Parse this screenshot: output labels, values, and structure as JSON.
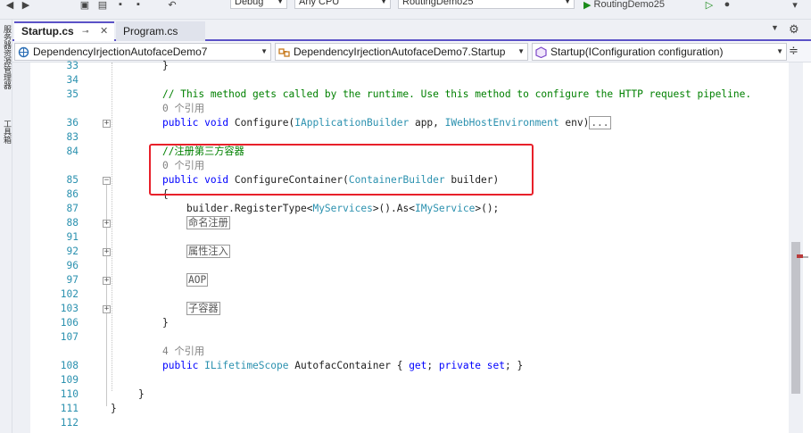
{
  "toolbar": {
    "config": "Debug",
    "platform": "Any CPU",
    "project": "RoutingDemo25",
    "run_target": "RoutingDemo25"
  },
  "left_strip": {
    "item1": "服务器资源管理器",
    "item2": "工具箱"
  },
  "tabs": [
    {
      "label": "Startup.cs",
      "active": true
    },
    {
      "label": "Program.cs",
      "active": false
    }
  ],
  "nav": {
    "project": "DependencyIrjectionAutofaceDemo7",
    "class": "DependencyIrjectionAutofaceDemo7.Startup",
    "member": "Startup(IConfiguration configuration)"
  },
  "code": {
    "l33_ln": "33",
    "l33_brace": "}",
    "l34_ln": "34",
    "l35_ln": "35",
    "l35_comment": "// This method gets called by the runtime. Use this method to configure the HTTP request pipeline.",
    "ref_0": "0 个引用",
    "l36_ln": "36",
    "l36_public": "public",
    "l36_void": "void",
    "l36_name": "Configure(",
    "l36_type1": "IApplicationBuilder",
    "l36_arg1": " app, ",
    "l36_type2": "IWebHostEnvironment",
    "l36_arg2": " env)",
    "ellipsis": "...",
    "l83_ln": "83",
    "l84_ln": "84",
    "l84_comment": "//注册第三方容器",
    "ref_0b": "0 个引用",
    "l85_ln": "85",
    "l85_public": "public",
    "l85_void": "void",
    "l85_name": "ConfigureContainer(",
    "l85_type": "ContainerBuilder",
    "l85_arg": " builder)",
    "l86_ln": "86",
    "l86_brace": "{",
    "l87_ln": "87",
    "l87_a": "builder.",
    "l87_b": "RegisterType<",
    "l87_c": "MyServices",
    "l87_d": ">().",
    "l87_e": "As<",
    "l87_f": "IMyService",
    "l87_g": ">();",
    "l88_ln": "88",
    "region1": "命名注册",
    "l91_ln": "91",
    "l92_ln": "92",
    "region2": "属性注入",
    "l96_ln": "96",
    "l97_ln": "97",
    "region3": "AOP",
    "l102_ln": "102",
    "l103_ln": "103",
    "region4": "子容器",
    "l106_ln": "106",
    "l106_brace": "}",
    "l107_ln": "107",
    "ref_4": "4 个引用",
    "l108_ln": "108",
    "l108_public": "public",
    "l108_type": "ILifetimeScope",
    "l108_name": " AutofacContainer { ",
    "l108_get": "get",
    "l108_sep": "; ",
    "l108_private": "private",
    "l108_set": "set",
    "l108_end": "; }",
    "l109_ln": "109",
    "l110_ln": "110",
    "l110_brace": "}",
    "l111_ln": "111",
    "l111_brace": "}",
    "l112_ln": "112"
  },
  "colors": {
    "keyword": "#0000ff",
    "type": "#2b91af",
    "comment": "#008000",
    "highlight_box": "#e8202a",
    "tab_accent": "#5b52c7"
  }
}
